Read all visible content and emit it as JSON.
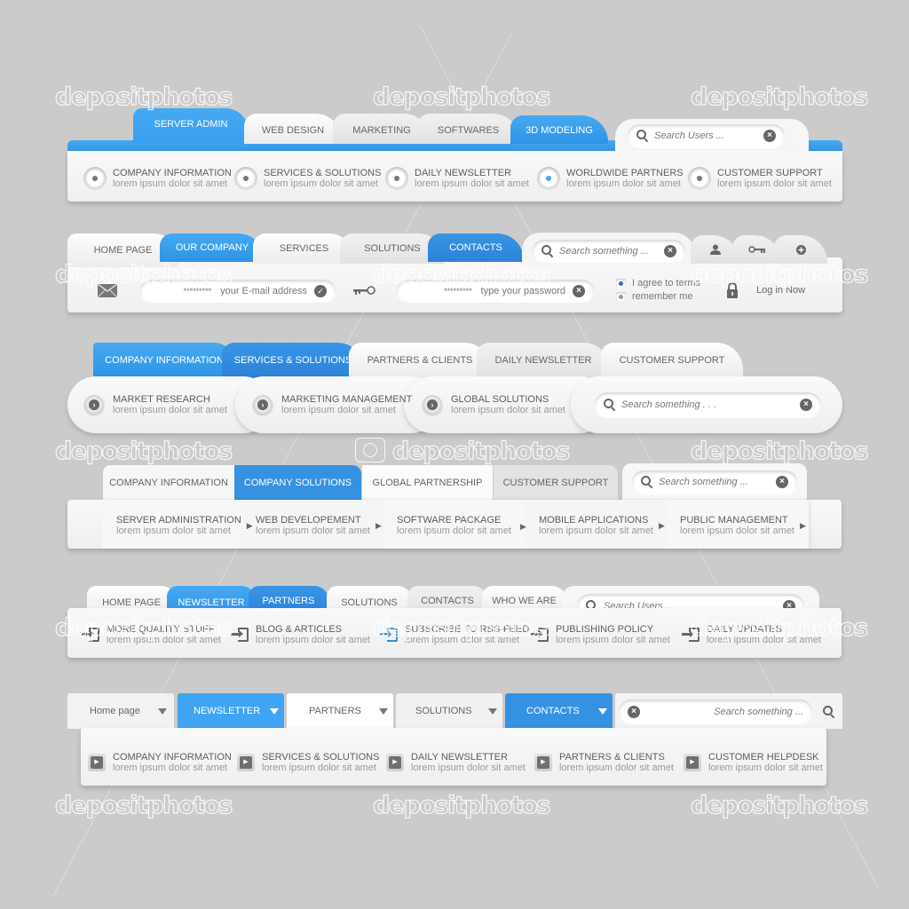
{
  "watermark": "depositphotos",
  "colors": {
    "accent": "#3a9ff0",
    "accent_dark": "#2c82d8",
    "background": "#cbcbcb",
    "panel": "#f4f4f4",
    "text": "#5e5e5e",
    "subtext": "#9a9a9a"
  },
  "nav1": {
    "tabs": [
      {
        "label": "SERVER ADMIN",
        "active": true
      },
      {
        "label": "WEB DESIGN",
        "active": false
      },
      {
        "label": "MARKETING",
        "active": false
      },
      {
        "label": "SOFTWARES",
        "active": false
      },
      {
        "label": "3D MODELING",
        "active": true
      }
    ],
    "search": {
      "placeholder": "Search Users ...",
      "icon": "search-icon",
      "clear_icon": "close-icon"
    },
    "items": [
      {
        "title": "COMPANY INFORMATION",
        "subtitle": "lorem ipsum dolor sit amet",
        "selected": false
      },
      {
        "title": "SERVICES & SOLUTIONS",
        "subtitle": "lorem ipsum dolor sit amet",
        "selected": false
      },
      {
        "title": "DAILY NEWSLETTER",
        "subtitle": "lorem ipsum dolor sit amet",
        "selected": false
      },
      {
        "title": "WORLDWIDE PARTNERS",
        "subtitle": "lorem ipsum dolor sit amet",
        "selected": true
      },
      {
        "title": "CUSTOMER SUPPORT",
        "subtitle": "lorem ipsum dolor sit amet",
        "selected": false
      }
    ]
  },
  "nav2": {
    "tabs": [
      {
        "label": "HOME PAGE",
        "active": false
      },
      {
        "label": "OUR COMPANY",
        "active": true
      },
      {
        "label": "SERVICES",
        "active": false
      },
      {
        "label": "SOLUTIONS",
        "active": false
      },
      {
        "label": "CONTACTS",
        "active": true
      }
    ],
    "search": {
      "placeholder": "Search something ..."
    },
    "icon_tabs": [
      "user-icon",
      "key-icon",
      "plus-icon"
    ],
    "login": {
      "email_mask": "*********",
      "email_placeholder": "your E-mail address",
      "password_mask": "*********",
      "password_placeholder": "type your password",
      "agree_label": "I agree to terms",
      "agree_checked": true,
      "remember_label": "remember me",
      "remember_checked": false,
      "login_label": "Log in Now"
    }
  },
  "nav3": {
    "tabs": [
      {
        "label": "COMPANY INFORMATION",
        "active": true
      },
      {
        "label": "SERVICES & SOLUTIONS",
        "active": true
      },
      {
        "label": "PARTNERS & CLIENTS",
        "active": false
      },
      {
        "label": "DAILY NEWSLETTER",
        "active": false
      },
      {
        "label": "CUSTOMER SUPPORT",
        "active": false
      }
    ],
    "items": [
      {
        "title": "MARKET RESEARCH",
        "subtitle": "lorem ipsum dolor sit amet"
      },
      {
        "title": "MARKETING MANAGEMENT",
        "subtitle": "lorem ipsum dolor sit amet"
      },
      {
        "title": "GLOBAL SOLUTIONS",
        "subtitle": "lorem ipsum dolor sit amet"
      }
    ],
    "search": {
      "placeholder": "Search something . . ."
    }
  },
  "nav4": {
    "tabs": [
      {
        "label": "COMPANY INFORMATION",
        "active": false
      },
      {
        "label": "COMPANY SOLUTIONS",
        "active": true
      },
      {
        "label": "GLOBAL PARTNERSHIP",
        "active": false
      },
      {
        "label": "CUSTOMER SUPPORT",
        "active": false
      }
    ],
    "search": {
      "placeholder": "Search something ..."
    },
    "items": [
      {
        "title": "SERVER ADMINISTRATION",
        "subtitle": "lorem ipsum dolor sit amet"
      },
      {
        "title": "WEB DEVELOPEMENT",
        "subtitle": "lorem ipsum dolor sit amet"
      },
      {
        "title": "SOFTWARE PACKAGE",
        "subtitle": "lorem ipsum dolor sit amet"
      },
      {
        "title": "MOBILE APPLICATIONS",
        "subtitle": "lorem ipsum dolor sit amet"
      },
      {
        "title": "PUBLIC MANAGEMENT",
        "subtitle": "lorem ipsum dolor sit amet"
      }
    ]
  },
  "nav5": {
    "tabs": [
      {
        "label": "HOME PAGE",
        "active": false
      },
      {
        "label": "NEWSLETTER",
        "active": true
      },
      {
        "label": "PARTNERS",
        "active": true
      },
      {
        "label": "SOLUTIONS",
        "active": false
      },
      {
        "label": "CONTACTS",
        "active": false
      },
      {
        "label": "WHO WE ARE",
        "active": false
      }
    ],
    "search": {
      "placeholder": "Search Users ..."
    },
    "items": [
      {
        "title": "MORE QUALITY STUFF",
        "subtitle": "lorem ipsum dolor sit amet",
        "highlight": false
      },
      {
        "title": "BLOG & ARTICLES",
        "subtitle": "lorem ipsum dolor sit amet",
        "highlight": false
      },
      {
        "title": "SUBSCRIBE TO RSS-FEED",
        "subtitle": "lorem ipsum dolor sit amet",
        "highlight": true
      },
      {
        "title": "PUBLISHING POLICY",
        "subtitle": "lorem ipsum dolor sit amet",
        "highlight": false
      },
      {
        "title": "DAILY UPDATES",
        "subtitle": "lorem ipsum dolor sit amet",
        "highlight": false
      }
    ]
  },
  "nav6": {
    "tabs": [
      {
        "label": "Home page",
        "active": false
      },
      {
        "label": "NEWSLETTER",
        "active": true
      },
      {
        "label": "PARTNERS",
        "active": false
      },
      {
        "label": "SOLUTIONS",
        "active": false
      },
      {
        "label": "CONTACTS",
        "active": true
      }
    ],
    "search": {
      "placeholder": "Search something ..."
    },
    "items": [
      {
        "title": "COMPANY INFORMATION",
        "subtitle": "lorem ipsum dolor sit amet"
      },
      {
        "title": "SERVICES & SOLUTIONS",
        "subtitle": "lorem ipsum dolor sit amet"
      },
      {
        "title": "DAILY NEWSLETTER",
        "subtitle": "lorem ipsum dolor sit amet"
      },
      {
        "title": "PARTNERS & CLIENTS",
        "subtitle": "lorem ipsum dolor sit amet"
      },
      {
        "title": "CUSTOMER HELPDESK",
        "subtitle": "lorem ipsum dolor sit amet"
      }
    ]
  }
}
